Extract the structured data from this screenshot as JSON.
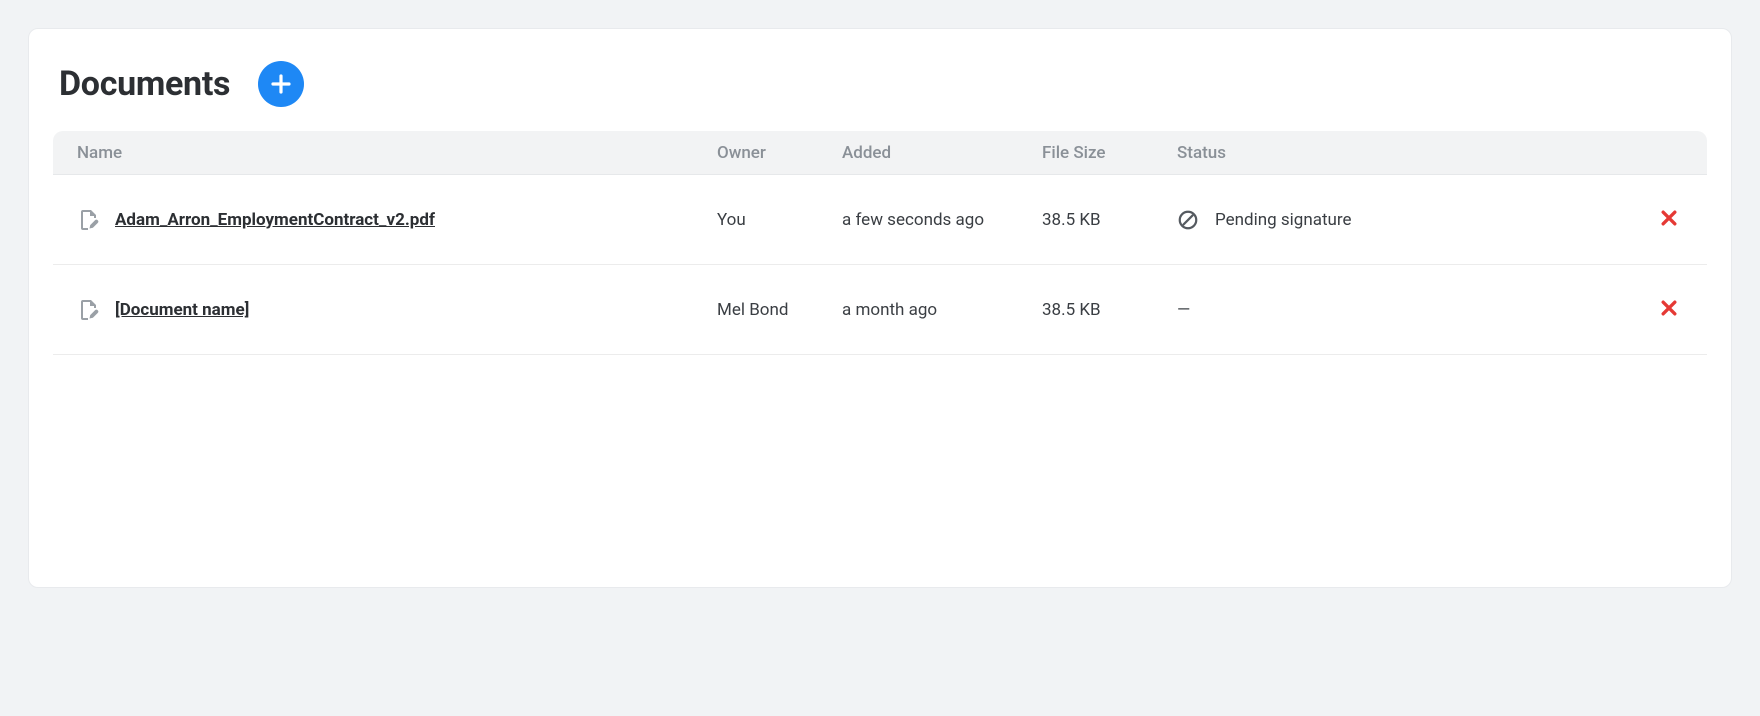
{
  "header": {
    "title": "Documents"
  },
  "table": {
    "columns": {
      "name": "Name",
      "owner": "Owner",
      "added": "Added",
      "size": "File Size",
      "status": "Status"
    },
    "rows": [
      {
        "name": "Adam_Arron_EmploymentContract_v2.pdf",
        "owner": "You",
        "added": "a few seconds ago",
        "size": "38.5 KB",
        "status": "Pending signature",
        "has_status_icon": true
      },
      {
        "name": "[Document name]",
        "owner": "Mel Bond",
        "added": "a month ago",
        "size": "38.5 KB",
        "status": "—",
        "has_status_icon": false
      }
    ]
  }
}
